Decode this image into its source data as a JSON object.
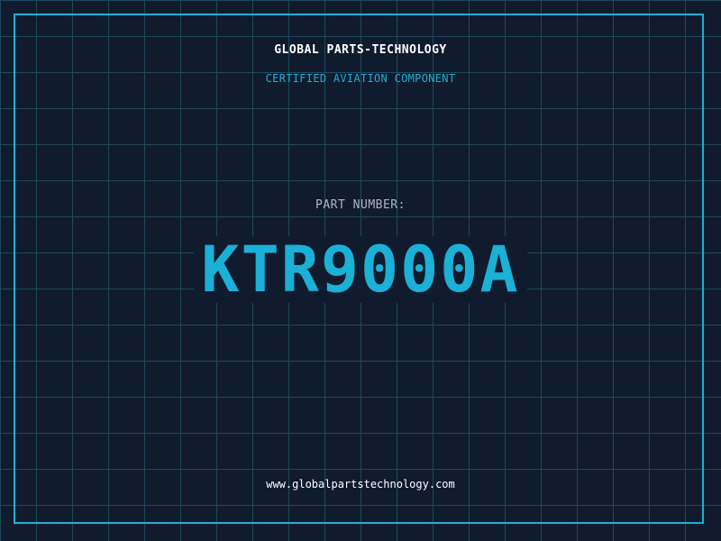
{
  "header": {
    "company": "GLOBAL PARTS-TECHNOLOGY",
    "subtitle": "CERTIFIED AVIATION COMPONENT"
  },
  "part": {
    "label": "PART NUMBER:",
    "value": "KTR9000A"
  },
  "footer": {
    "url": "www.globalpartstechnology.com"
  },
  "colors": {
    "background": "#111b2e",
    "grid": "#1d4a5c",
    "accent": "#1bb0d6",
    "text": "#ffffff",
    "muted": "#aeb6c4"
  }
}
